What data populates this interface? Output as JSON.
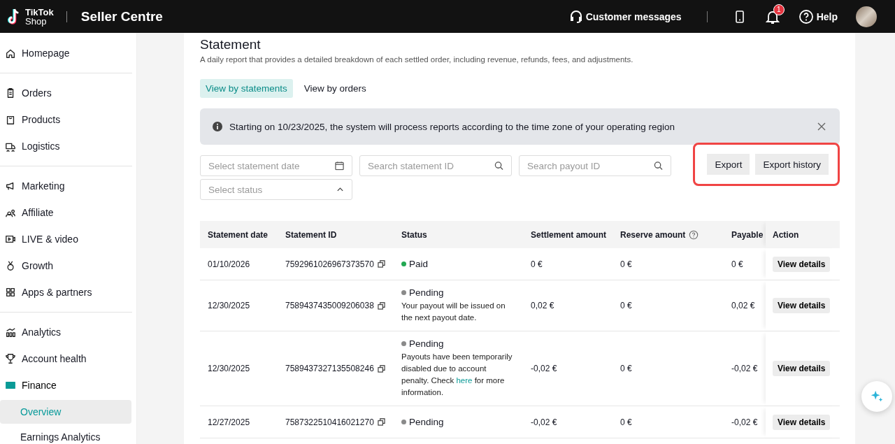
{
  "header": {
    "logo_lines": [
      "TikTok",
      "Shop"
    ],
    "title": "Seller Centre",
    "customer_messages": "Customer messages",
    "notification_count": "1",
    "help": "Help"
  },
  "sidebar": {
    "groups": [
      [
        {
          "label": "Homepage",
          "selected": false
        }
      ],
      [
        {
          "label": "Orders",
          "selected": false
        },
        {
          "label": "Products",
          "selected": false
        },
        {
          "label": "Logistics",
          "selected": false
        }
      ],
      [
        {
          "label": "Marketing",
          "selected": false
        },
        {
          "label": "Affiliate",
          "selected": false
        },
        {
          "label": "LIVE & video",
          "selected": false
        },
        {
          "label": "Growth",
          "selected": false
        },
        {
          "label": "Apps & partners",
          "selected": false
        }
      ],
      [
        {
          "label": "Analytics",
          "selected": false
        },
        {
          "label": "Account health",
          "selected": false
        },
        {
          "label": "Finance",
          "selected": false,
          "expanded": true,
          "children": [
            {
              "label": "Overview",
              "selected": true
            },
            {
              "label": "Earnings Analytics",
              "selected": false
            }
          ]
        }
      ]
    ]
  },
  "page": {
    "title": "Statement",
    "description": "A daily report that provides a detailed breakdown of each settled order, including revenue, refunds, fees, and adjustments.",
    "view_tabs": [
      {
        "label": "View by statements",
        "selected": true
      },
      {
        "label": "View by orders",
        "selected": false
      }
    ],
    "notice": "Starting on 10/23/2025, the system will process reports according to the time zone of your operating region",
    "filters": {
      "date_placeholder": "Select statement date",
      "statement_id_placeholder": "Search statement ID",
      "payout_id_placeholder": "Search payout ID",
      "status_placeholder": "Select status",
      "status_expanded": true
    },
    "buttons": [
      "Export",
      "Export history"
    ],
    "table": {
      "columns": [
        "Statement date",
        "Statement ID",
        "Status",
        "Settlement amount",
        "Reserve amount",
        "Payable",
        "Action"
      ],
      "rows": [
        {
          "date": "01/10/2026",
          "id": "7592961026967373570",
          "status": "Paid",
          "color": "#22a852",
          "note": "",
          "settlement": "0 €",
          "reserve": "0 €",
          "payable": "0 €",
          "action": "View details"
        },
        {
          "date": "12/30/2025",
          "id": "7589437435009206038",
          "status": "Pending",
          "color": "#8a8a8a",
          "note": "Your payout will be issued on the next payout date.",
          "settlement": "0,02 €",
          "reserve": "0 €",
          "payable": "0,02 €",
          "action": "View details"
        },
        {
          "date": "12/30/2025",
          "id": "7589437327135508246",
          "status": "Pending",
          "color": "#8a8a8a",
          "note": "Payouts have been temporarily disabled due to account penalty. Check ",
          "link": "here",
          "note_after": " for more information.",
          "settlement": "-0,02 €",
          "reserve": "0 €",
          "payable": "-0,02 €",
          "action": "View details"
        },
        {
          "date": "12/27/2025",
          "id": "7587322510416021270",
          "status": "Pending",
          "color": "#8a8a8a",
          "note": "",
          "settlement": "-0,02 €",
          "reserve": "0 €",
          "payable": "-0,02 €",
          "action": "View details"
        }
      ]
    }
  }
}
